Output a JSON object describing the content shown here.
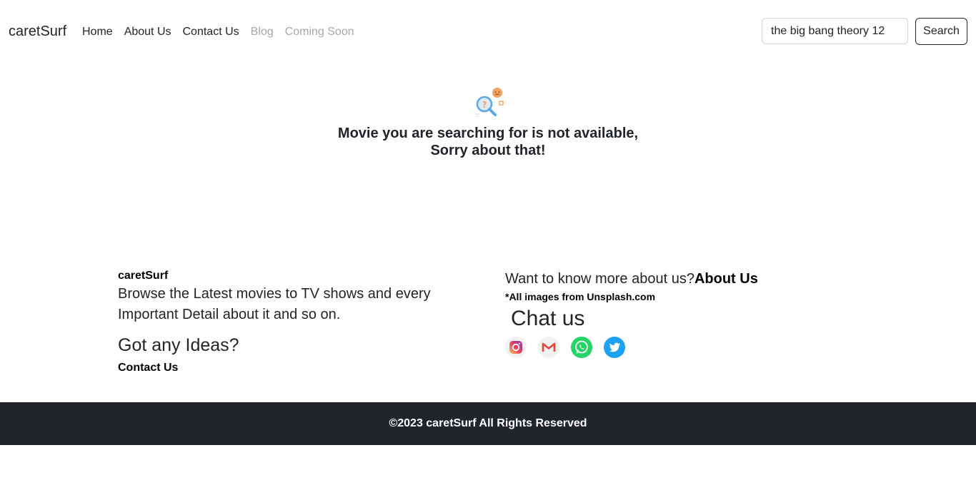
{
  "navbar": {
    "brand": "caretSurf",
    "links": [
      {
        "label": "Home",
        "muted": false
      },
      {
        "label": "About Us",
        "muted": false
      },
      {
        "label": "Contact Us",
        "muted": false
      },
      {
        "label": "Blog",
        "muted": true
      },
      {
        "label": "Coming Soon",
        "muted": true
      }
    ],
    "search_value": "the big bang theory 12",
    "search_button": "Search"
  },
  "empty_state": {
    "icon": "search-not-found-icon",
    "line1": "Movie you are searching for is not available,",
    "line2": "Sorry about that!"
  },
  "footer": {
    "brand": "caretSurf",
    "description": "Browse the Latest movies to TV shows and every Important Detail about it and so on.",
    "ideas_heading": "Got any Ideas?",
    "contact_link": "Contact Us",
    "know_more": "Want to know more about us?",
    "about_link": "About Us",
    "image_credit": "*All images from Unsplash.com",
    "chat_heading": "Chat us",
    "socials": [
      "instagram-icon",
      "gmail-icon",
      "whatsapp-icon",
      "twitter-icon"
    ]
  },
  "bottom_bar": {
    "copyright": "©2023 caretSurf All Rights Reserved"
  },
  "colors": {
    "dark": "#212529",
    "muted_link": "#a5a8ab",
    "empty_icon_blue": "#5aa9e6",
    "empty_icon_orange": "#f4a261"
  }
}
